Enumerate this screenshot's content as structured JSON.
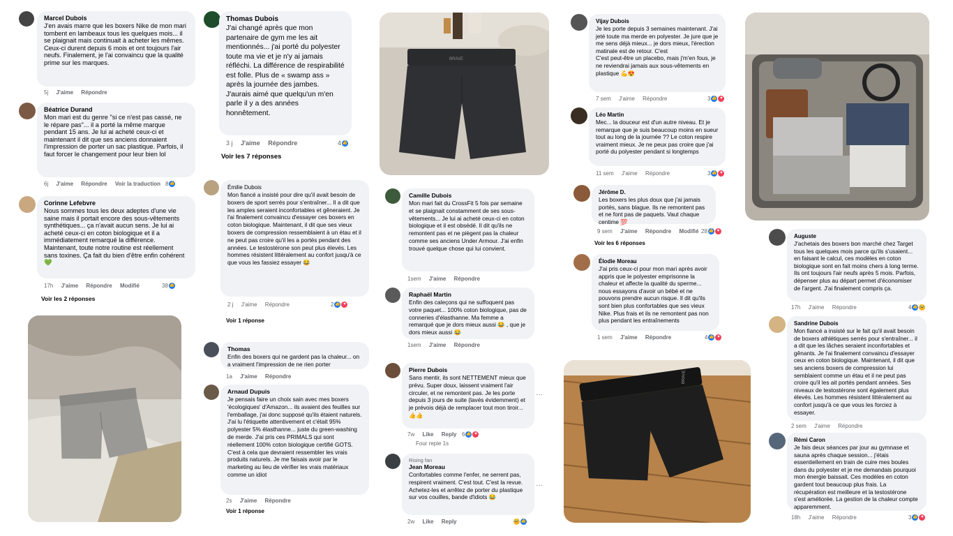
{
  "comments": [
    {
      "name": "Marcel Dubois",
      "text": "J'en avais marre que les boxers Nike de mon mari tombent en lambeaux tous les quelques mois... il se plaignait mais continuait à acheter les mêmes. Ceux-ci durent depuis 6 mois et ont toujours l'air neufs. Finalement, je l'ai convaincu que la qualité prime sur les marques.",
      "time": "5j",
      "like": "J'aime",
      "reply": "Répondre"
    },
    {
      "name": "Béatrice Durand",
      "text": "Mon mari est du genre \"si ce n'est pas cassé, ne le répare pas\"... il a porté la même marque pendant 15 ans. Je lui ai acheté ceux-ci et maintenant il dit que ses anciens donnaient l'impression de porter un sac plastique. Parfois, il faut forcer le changement pour leur bien lol",
      "time": "6j",
      "like": "J'aime",
      "reply": "Répondre",
      "translate": "Voir la traduction",
      "count": "8"
    },
    {
      "name": "Corinne Lefebvre",
      "text": "Nous sommes tous les deux adeptes d'une vie saine mais il portait encore des sous-vêtements synthétiques... ça n'avait aucun sens. Je lui ai acheté ceux-ci en coton biologique et il a immédiatement remarqué la différence. Maintenant, toute notre routine est réellement sans toxines. Ça fait du bien d'être enfin cohérent 💚",
      "time": "17h",
      "like": "J'aime",
      "reply": "Répondre",
      "edited": "Modifié",
      "count": "38",
      "replies": "Voir les 2 réponses"
    },
    {
      "name": "Thomas Dubois",
      "text": "J'ai changé après que mon partenaire de gym me les ait mentionnés... j'ai porté du polyester toute ma vie et je n'y ai jamais réfléchi. La différence de respirabilité est folle. Plus de « swamp ass » après la journée des jambes. J'aurais aimé que quelqu'un m'en parle il y a des années honnêtement.",
      "time": "3 j",
      "like": "J'aime",
      "reply": "Répondre",
      "count": "4",
      "replies": "Voir les 7 réponses"
    },
    {
      "name": "Émilie Dubois",
      "text": "Mon fiancé a insisté pour dire qu'il avait besoin de boxers de sport serrés pour s'entraîner... Il a dit que les amples seraient inconfortables et gêneraient. Je l'ai finalement convaincu d'essayer ces boxers en coton biologique. Maintenant, il dit que ses vieux boxers de compression ressemblaient à un étau et il ne peut pas croire qu'il les a portés pendant des années. Le testostérone son peut plus élevés. Les hommes résistent littéralement au confort jusqu'à ce que vous les fassiez essayer 😂",
      "time": "2 j",
      "like": "J'aime",
      "reply": "Répondre",
      "count": "2",
      "replies": "Voir 1 réponse"
    },
    {
      "name": "Thomas",
      "text": "Enfin des boxers qui ne gardent pas la chaleur... on a vraiment l'impression de ne rien porter",
      "time": "1a",
      "like": "J'aime",
      "reply": "Répondre"
    },
    {
      "name": "Arnaud Dupuis",
      "text": "Je pensais faire un choix sain avec mes boxers 'écologiques' d'Amazon... ils avaient des feuilles sur l'emballage, j'ai donc supposé qu'ils étaient naturels. J'ai lu l'étiquette attentivement et c'était 95% polyester 5% élasthanne... juste du green-washing de merde. J'ai pris ces PRIMALS qui sont réellement 100% coton biologique certifié GOTS. C'est à cela que devraient ressembler les vrais produits naturels. Je me faisais avoir par le marketing au lieu de vérifier les vrais matériaux comme un idiot",
      "time": "2s",
      "like": "J'aime",
      "reply": "Répondre",
      "replies": "Voir 1 réponse"
    },
    {
      "name": "Camille Dubois",
      "text": "Mon mari fait du CrossFit 5 fois par semaine et se plaignait constamment de ses sous-vêtements... Je lui ai acheté ceux-ci en coton biologique et il est obsédé. Il dit qu'ils ne remontent pas et ne piègent pas la chaleur comme ses anciens Under Armour. J'ai enfin trouvé quelque chose qui lui convient.",
      "time": "1sem",
      "like": "J'aime",
      "reply": "Répondre"
    },
    {
      "name": "Raphaël Martin",
      "text": "Enfin des caleçons qui ne suffoquent pas votre paquet... 100% coton biologique, pas de conneries d'élasthanne. Ma femme a remarqué que je dors mieux aussi 😂 , que je dors mieux aussi 😂",
      "time": "1sem",
      "like": "J'aime",
      "reply": "Répondre"
    },
    {
      "name": "Pierre Dubois",
      "text": "Sans mentir, ils sont NETTEMENT mieux que prévu. Super doux, laissent vraiment l'air circuler, et ne remontent pas. Je les porte depuis 3 jours de suite (lavés évidemment) et je prévois déjà de remplacer tout mon tiroir... 👍👍",
      "time": "7w",
      "like": "Like",
      "reply": "Reply",
      "count": "6",
      "sub": "Four repie 1s"
    },
    {
      "name": "Jean Moreau",
      "fan": "Rising fan",
      "text": "Confortables comme l'enfer, ne serrent pas, respirent vraiment. C'est tout. C'est la revue. Achetez-les et arrêtez de porter du plastique sur vos couilles, bande d'idiots 😂",
      "time": "2w",
      "like": "Like",
      "reply": "Reply"
    },
    {
      "name": "Vijay Dubois",
      "text": "Je les porte depuis 3 semaines maintenant. J'ai jeté toute ma merde en polyester. Je jure que je me sens déjà mieux... je dors mieux, l'érection matinale est de retour. C'est\nC'est peut-être un placebo, mais j'm'en fous, je ne reviendrai jamais aux sous-vêtements en plastique 💪😍",
      "time": "7 sem",
      "like": "J'aime",
      "reply": "Répondre",
      "count": "3"
    },
    {
      "name": "Léo Martin",
      "text": "Mec... la douceur est d'un autre niveau. Et je remarque que je suis beaucoup moins en sueur tout au long de la journée ?? Le coton respire vraiment mieux. Je ne peux pas croire que j'ai porté du polyester pendant si longtemps",
      "time": "11 sem",
      "like": "J'aime",
      "reply": "Répondre",
      "count": "3"
    },
    {
      "name": "Jérôme D.",
      "text": "Les boxers les plus doux que j'ai jamais portés, sans blague. Ils ne remontent pas et ne font pas de paquets. Vaut chaque centime 💯",
      "time": "9 sem",
      "like": "J'aime",
      "reply": "Répondre",
      "edited": "Modifié",
      "count": "28",
      "replies": "Voir les 6 réponses"
    },
    {
      "name": "Élodie Moreau",
      "text": "J'ai pris ceux-ci pour mon mari après avoir appris que le polyester emprisonne la chaleur et affecte la qualité du sperme... nous essayons d'avoir un bébé et ne pouvons prendre aucun risque. Il dit qu'ils sont bien plus confortables que ses vieux Nike. Plus frais et ils ne remontent pas non plus pendant les entraînements",
      "time": "1 sem",
      "like": "J'aime",
      "reply": "Répondre",
      "count": "4"
    },
    {
      "name": "Auguste",
      "text": "J'achetais des boxers bon marché chez Target tous les quelques mois parce qu'ils s'usaient... en faisant le calcul, ces modèles en coton biologique sont en fait moins chers à long terme. Ils ont toujours l'air neufs après 5 mois. Parfois, dépenser plus au départ permet d'économiser de l'argent. J'ai finalement compris ça.",
      "time": "17h",
      "like": "J'aime",
      "reply": "Répondre",
      "count": "4"
    },
    {
      "name": "Sandrine Dubois",
      "text": "Mon fiancé a insisté sur le fait qu'il avait besoin de boxers athlétiques serrés pour s'entraîner... il a dit que les lâches seraient inconfortables et gênants. Je l'ai finalement convaincu d'essayer ceux en coton biologique. Maintenant, il dit que ses anciens boxers de compression lui semblaient comme un étau et il ne peut pas croire qu'il les ait portés pendant années. Ses niveaux de testostérone sont également plus élevés. Les hommes résistent littéralement au confort jusqu'à ce que vous les forciez à essayer.",
      "time": "2 sem",
      "like": "J'aime",
      "reply": "Répondre"
    },
    {
      "name": "Rémi Caron",
      "text": "Je fais deux séances par jour au gymnase et sauna après chaque session... j'étais essentiellement en train de cuire mes boules dans du polyester et je me demandais pourquoi mon énergie baissait. Ces modèles en coton gardent tout beaucoup plus frais. La récupération est meilleure et la testostérone s'est améliorée. La gestion de la chaleur compte apparemment.",
      "time": "18h",
      "like": "J'aime",
      "reply": "Répondre",
      "count": "3"
    }
  ],
  "brand": "BRAVE",
  "colors": {
    "bubble": "#f0f2f5",
    "like": "#1877f2",
    "heart": "#f33e58",
    "haha": "#f7b125",
    "meta": "#65676b"
  }
}
